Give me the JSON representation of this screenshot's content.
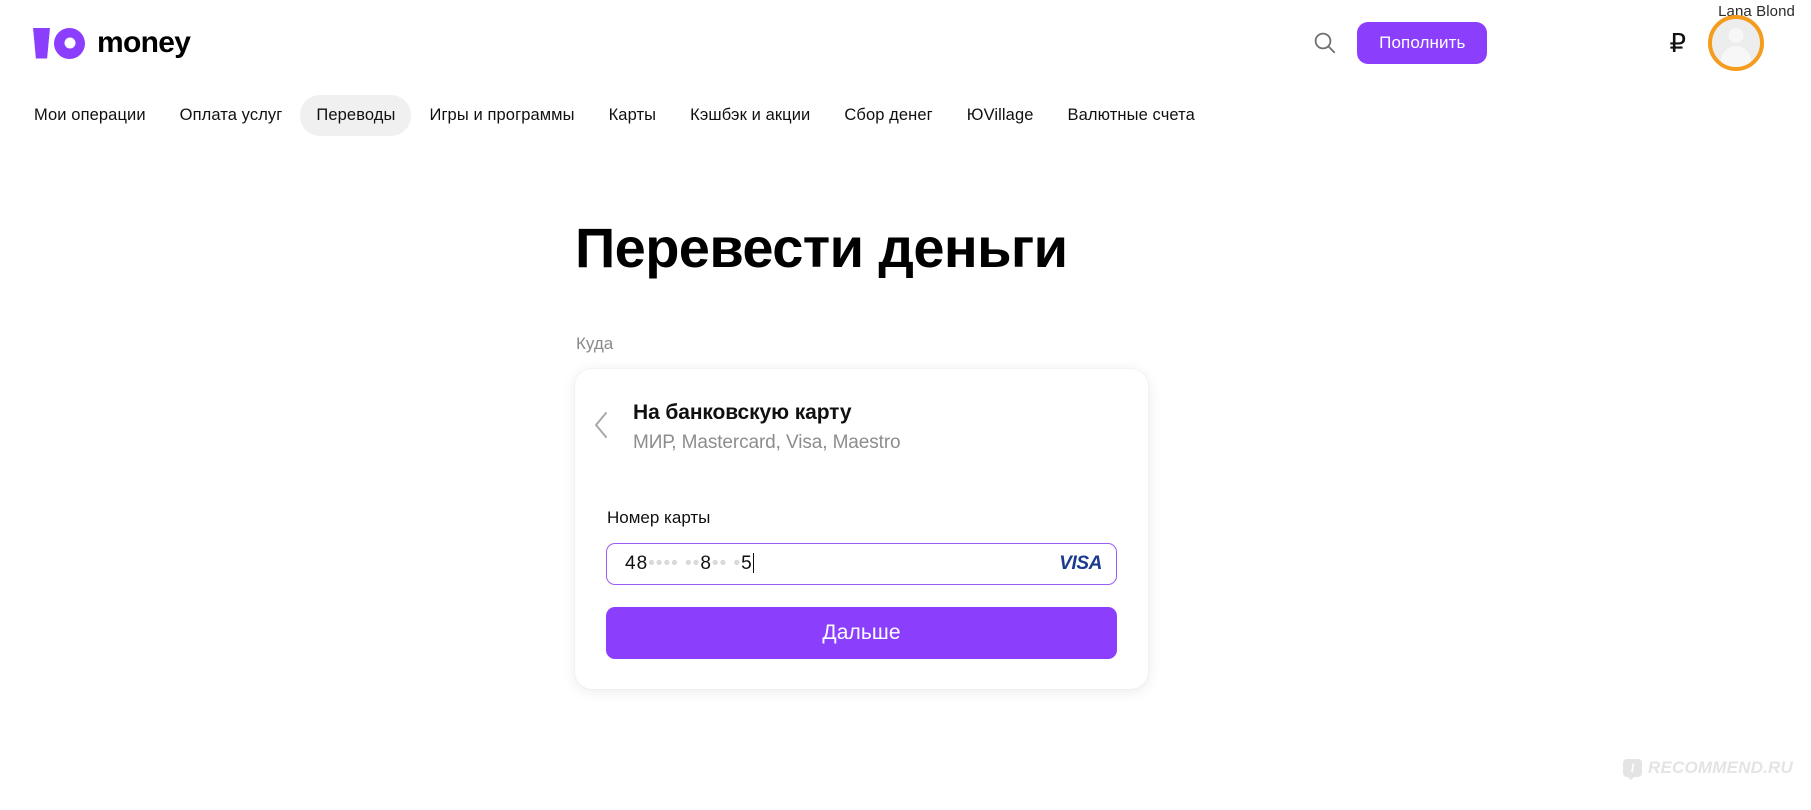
{
  "header": {
    "logo": {
      "mark_icon": "yoomoney-logo-icon",
      "text": "money"
    },
    "search_icon": "search-icon",
    "topup_label": "Пополнить",
    "currency_symbol": "₽",
    "avatar_icon": "user-avatar-icon",
    "user_name": "Lana Blond",
    "accent_color": "#8B3FFD",
    "avatar_highlight_color": "#F59B1E"
  },
  "nav": {
    "items": [
      {
        "label": "Мои операции",
        "active": false
      },
      {
        "label": "Оплата услуг",
        "active": false
      },
      {
        "label": "Переводы",
        "active": true
      },
      {
        "label": "Игры и программы",
        "active": false
      },
      {
        "label": "Карты",
        "active": false
      },
      {
        "label": "Кэшбэк и акции",
        "active": false
      },
      {
        "label": "Сбор денег",
        "active": false
      },
      {
        "label": "ЮVillage",
        "active": false
      },
      {
        "label": "Валютные счета",
        "active": false
      }
    ]
  },
  "main": {
    "page_title": "Перевести деньги",
    "destination_label": "Куда",
    "card": {
      "back_icon": "chevron-left-icon",
      "destination_title": "На банковскую карту",
      "destination_subtitle": "МИР, Mastercard, Visa, Maestro",
      "input_label": "Номер карты",
      "card_number_visible_prefix": "48",
      "card_number_masked_1": "•••• ••",
      "card_number_visible_mid": "8",
      "card_number_masked_2": "•• •",
      "card_number_visible_suffix": "5",
      "card_brand_icon": "visa-logo-icon",
      "card_brand_label": "VISA",
      "submit_label": "Дальше",
      "input_focus_color": "#9B5CF6"
    }
  },
  "watermark": {
    "badge_letter": "I",
    "text": "RECOMMEND.RU"
  }
}
